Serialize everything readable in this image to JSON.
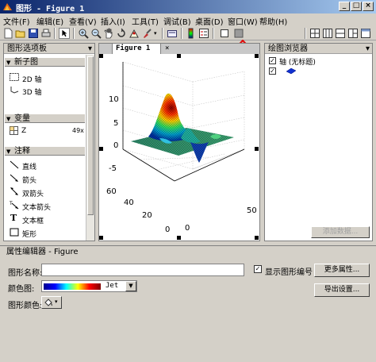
{
  "window": {
    "title": "图形 - Figure 1"
  },
  "menu": [
    "文件(F)",
    "编辑(E)",
    "查看(V)",
    "插入(I)",
    "工具(T)",
    "调试(B)",
    "桌面(D)",
    "窗口(W)",
    "帮助(H)"
  ],
  "toolbar": {
    "icons": [
      "new-figure-icon",
      "open-folder-icon",
      "save-icon",
      "print-icon",
      "pointer-icon",
      "zoom-in-icon",
      "zoom-out-icon",
      "pan-hand-icon",
      "rotate-3d-icon",
      "data-cursor-icon",
      "brush-icon",
      "link-icon",
      "colorbar-icon",
      "legend-icon",
      "hide-tools-icon",
      "show-tools-icon",
      "grid-layout-icon"
    ]
  },
  "palette": {
    "title": "图形选项板",
    "sections": [
      {
        "label": "新子图",
        "items": [
          "2D 轴",
          "3D 轴"
        ]
      },
      {
        "label": "变量",
        "items": [
          "Z"
        ],
        "badge": "49x"
      },
      {
        "label": "注释",
        "items": [
          "直线",
          "箭头",
          "双箭头",
          "文本箭头",
          "文本框",
          "矩形"
        ]
      }
    ]
  },
  "figure_tab": {
    "label": "Figure 1"
  },
  "plot": {
    "z_ticks": [
      "10",
      "5",
      "0",
      "-5"
    ],
    "y_ticks": [
      "60",
      "40",
      "20",
      "0"
    ],
    "x_ticks": [
      "0",
      "50"
    ]
  },
  "browser": {
    "title": "绘图浏览器",
    "items": [
      "轴 (无标题)",
      ""
    ],
    "add_data_label": "添加数据..."
  },
  "property_editor": {
    "title": "属性编辑器 - Figure",
    "figure_name_label": "图形名称:",
    "figure_name_value": "",
    "show_number_label": "显示图形编号",
    "show_number_checked": true,
    "colormap_label": "颜色图:",
    "colormap_value": "Jet",
    "figure_color_label": "图形颜色:",
    "more_props_label": "更多属性...",
    "export_label": "导出设置..."
  },
  "colors": {
    "accent_arrow": "#e01010",
    "selection": "#0a246a"
  }
}
